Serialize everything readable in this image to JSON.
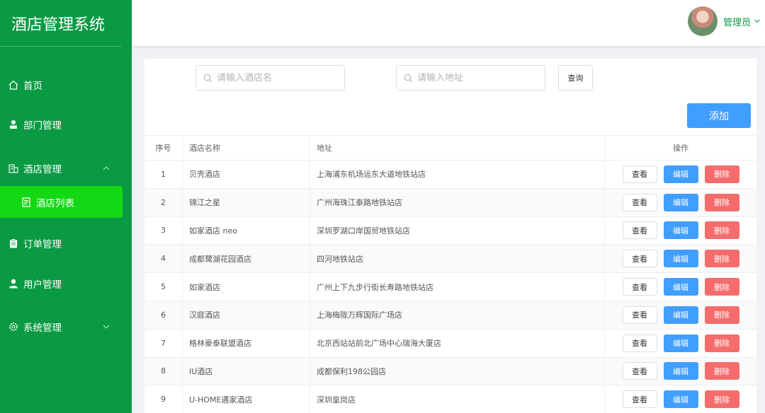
{
  "app": {
    "title": "酒店管理系统"
  },
  "sidebar": {
    "items": [
      {
        "label": "首页",
        "icon": "home-icon"
      },
      {
        "label": "部门管理",
        "icon": "person-icon"
      },
      {
        "label": "酒店管理",
        "icon": "building-icon",
        "expanded": true
      },
      {
        "label": "订单管理",
        "icon": "clipboard-icon"
      },
      {
        "label": "用户管理",
        "icon": "user-icon"
      },
      {
        "label": "系统管理",
        "icon": "gear-icon"
      }
    ],
    "submenu": {
      "label": "酒店列表",
      "icon": "document-icon",
      "active": true
    }
  },
  "header": {
    "user_name": "管理员"
  },
  "search": {
    "name_placeholder": "请输入酒店名",
    "address_placeholder": "请输入地址",
    "query_label": "查询",
    "add_label": "添加"
  },
  "table": {
    "columns": [
      "序号",
      "酒店名称",
      "地址",
      "操作"
    ],
    "actions": {
      "view": "查看",
      "edit": "编辑",
      "delete": "删除"
    },
    "rows": [
      {
        "idx": "1",
        "name": "贝壳酒店",
        "address": "上海浦东机场远东大道地铁站店"
      },
      {
        "idx": "2",
        "name": "锦江之星",
        "address": "广州海珠江泰路地铁站店"
      },
      {
        "idx": "3",
        "name": "如家酒店 neo",
        "address": "深圳罗湖口岸国贸地铁站店"
      },
      {
        "idx": "4",
        "name": "成都鹭湖花园酒店",
        "address": "四河地铁站店"
      },
      {
        "idx": "5",
        "name": "如家酒店",
        "address": "广州上下九步行街长寿路地铁站店"
      },
      {
        "idx": "6",
        "name": "汉庭酒店",
        "address": "上海梅陇万辉国际广场店"
      },
      {
        "idx": "7",
        "name": "格林豪泰联盟酒店",
        "address": "北京西站站前北广场中心瑞海大厦店"
      },
      {
        "idx": "8",
        "name": "IU酒店",
        "address": "成都保利198公园店"
      },
      {
        "idx": "9",
        "name": "U-HOME遇家酒店",
        "address": "深圳皇岗店"
      }
    ]
  },
  "colors": {
    "sidebar": "#0a9a43",
    "active": "#14d814",
    "primary": "#409eff",
    "danger": "#f56c6c"
  }
}
